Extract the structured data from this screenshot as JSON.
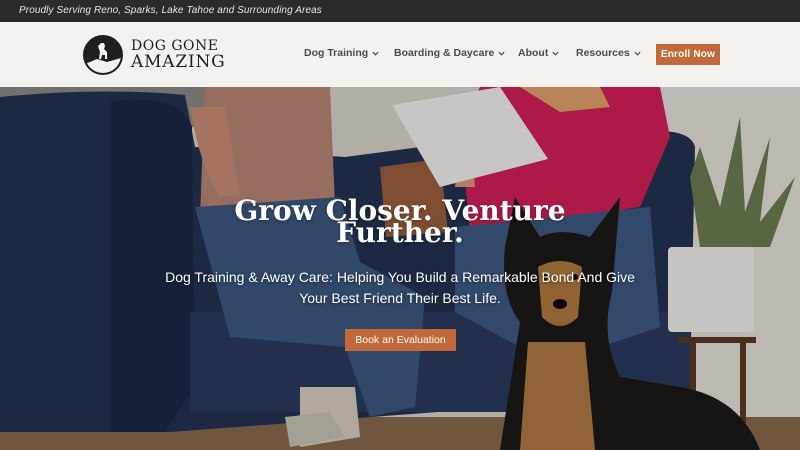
{
  "topbar": {
    "tagline": "Proudly Serving Reno, Sparks, Lake Tahoe and Surrounding Areas"
  },
  "logo": {
    "line1": "DOG GONE",
    "line2": "AMAZING"
  },
  "nav": {
    "items": [
      {
        "label": "Dog Training"
      },
      {
        "label": "Boarding & Daycare"
      },
      {
        "label": "About"
      },
      {
        "label": "Resources"
      }
    ],
    "cta": "Enroll Now"
  },
  "hero": {
    "headline": "Grow Closer. Venture Further.",
    "subhead": "Dog Training & Away Care: Helping You Build a Remarkable Bond And Give Your Best Friend Their Best Life.",
    "button": "Book an Evaluation"
  },
  "colors": {
    "accent": "#c1693a",
    "topbar": "#2b2b2b",
    "nav_bg": "#f4f2ee",
    "text": "#4a4a4a"
  }
}
